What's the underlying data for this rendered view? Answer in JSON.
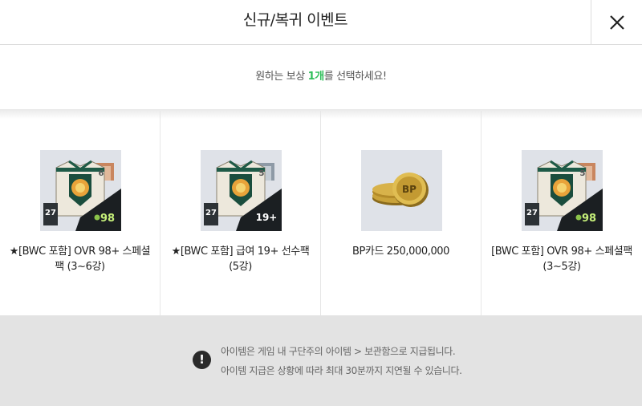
{
  "header": {
    "title": "신규/복귀 이벤트",
    "close_icon": "close-icon"
  },
  "subtitle": {
    "before": "원하는 보상 ",
    "count": "1개",
    "after": "를 선택하세요!",
    "accent_color": "#2fbe5a"
  },
  "rewards": [
    {
      "label": "★[BWC 포함] OVR 98+ 스페셜 팩 (3~6강)",
      "icon": "player-pack-icon",
      "level": "6",
      "ovr": "27",
      "badge": "98"
    },
    {
      "label": "★[BWC 포함] 급여 19+ 선수팩 (5강)",
      "icon": "player-pack-icon",
      "level": "5",
      "ovr": "27",
      "badge": "19+"
    },
    {
      "label": "BP카드 250,000,000",
      "icon": "bp-coins-icon",
      "coin_text": "BP"
    },
    {
      "label": "[BWC 포함] OVR 98+ 스페셜팩 (3~5강)",
      "icon": "player-pack-icon",
      "level": "5",
      "ovr": "27",
      "badge": "98"
    }
  ],
  "notice": {
    "icon": "exclamation-icon",
    "mark": "!",
    "lines": [
      "아이템은 게임 내 구단주의 아이템 > 보관함으로 지급됩니다.",
      "아이템 지급은 상황에 따라 최대 30분까지 지연될 수 있습니다."
    ]
  }
}
